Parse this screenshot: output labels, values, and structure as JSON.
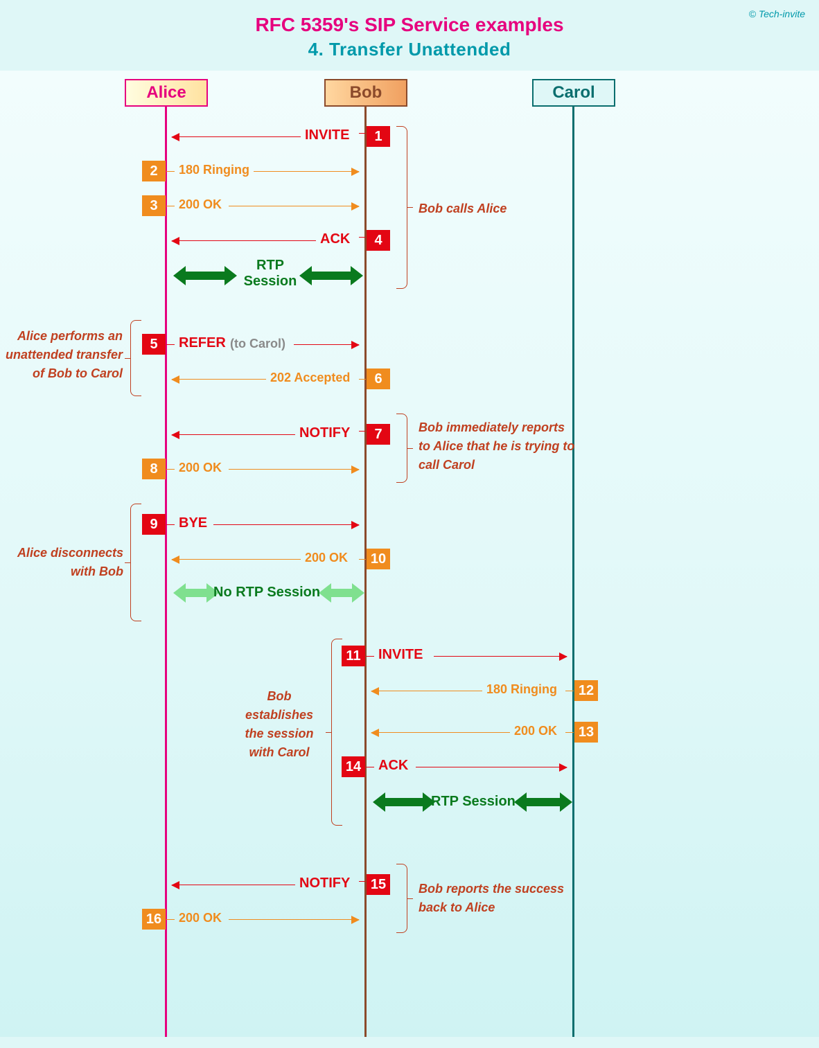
{
  "header": {
    "title_line1": "RFC 5359's SIP Service examples",
    "title_line2": "4. Transfer Unattended",
    "copyright": "© Tech-invite"
  },
  "actors": {
    "alice": "Alice",
    "bob": "Bob",
    "carol": "Carol"
  },
  "steps": {
    "s1": {
      "num": "1",
      "label": "INVITE"
    },
    "s2": {
      "num": "2",
      "label": "180 Ringing"
    },
    "s3": {
      "num": "3",
      "label": "200 OK"
    },
    "s4": {
      "num": "4",
      "label": "ACK"
    },
    "s5": {
      "num": "5",
      "label": "REFER",
      "suffix": "(to Carol)"
    },
    "s6": {
      "num": "6",
      "label": "202 Accepted"
    },
    "s7": {
      "num": "7",
      "label": "NOTIFY"
    },
    "s8": {
      "num": "8",
      "label": "200 OK"
    },
    "s9": {
      "num": "9",
      "label": "BYE"
    },
    "s10": {
      "num": "10",
      "label": "200 OK"
    },
    "s11": {
      "num": "11",
      "label": "INVITE"
    },
    "s12": {
      "num": "12",
      "label": "180 Ringing"
    },
    "s13": {
      "num": "13",
      "label": "200 OK"
    },
    "s14": {
      "num": "14",
      "label": "ACK"
    },
    "s15": {
      "num": "15",
      "label": "NOTIFY"
    },
    "s16": {
      "num": "16",
      "label": "200 OK"
    }
  },
  "sessions": {
    "rtp1": "RTP\nSession",
    "no_rtp": "No RTP Session",
    "rtp2": "RTP Session"
  },
  "notes": {
    "n1": "Bob calls Alice",
    "n2": "Alice performs an\nunattended transfer\nof Bob to Carol",
    "n3": "Bob immediately reports\nto Alice that he is trying to\ncall Carol",
    "n4": "Alice disconnects\nwith Bob",
    "n5": "Bob\nestablishes\nthe session\nwith Carol",
    "n6": "Bob reports the success\nback to Alice"
  }
}
